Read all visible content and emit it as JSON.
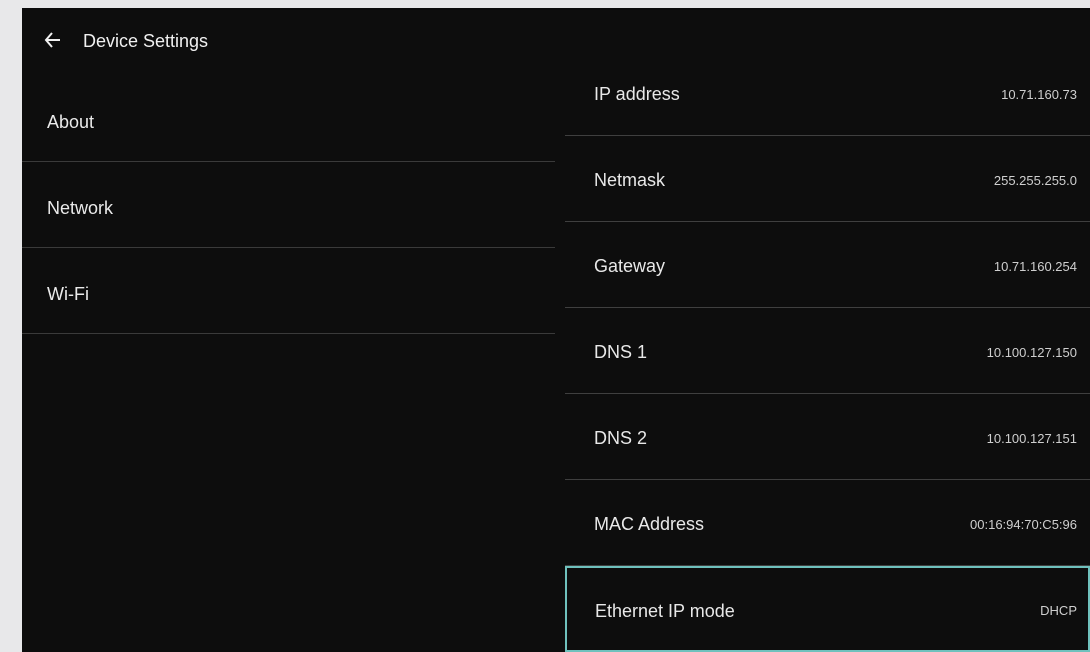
{
  "header": {
    "back_icon": "arrow-left-icon",
    "title": "Device Settings"
  },
  "sidebar": {
    "items": [
      {
        "label": "About"
      },
      {
        "label": "Network"
      },
      {
        "label": "Wi-Fi"
      }
    ]
  },
  "network": {
    "rows": [
      {
        "label": "IP address",
        "value": "10.71.160.73"
      },
      {
        "label": "Netmask",
        "value": "255.255.255.0"
      },
      {
        "label": "Gateway",
        "value": "10.71.160.254"
      },
      {
        "label": "DNS 1",
        "value": "10.100.127.150"
      },
      {
        "label": "DNS 2",
        "value": "10.100.127.151"
      },
      {
        "label": "MAC Address",
        "value": "00:16:94:70:C5:96"
      },
      {
        "label": "Ethernet IP mode",
        "value": "DHCP"
      }
    ]
  },
  "colors": {
    "background": "#0d0d0d",
    "focus_border": "#6fc1bd",
    "divider": "#3f3f3f"
  }
}
